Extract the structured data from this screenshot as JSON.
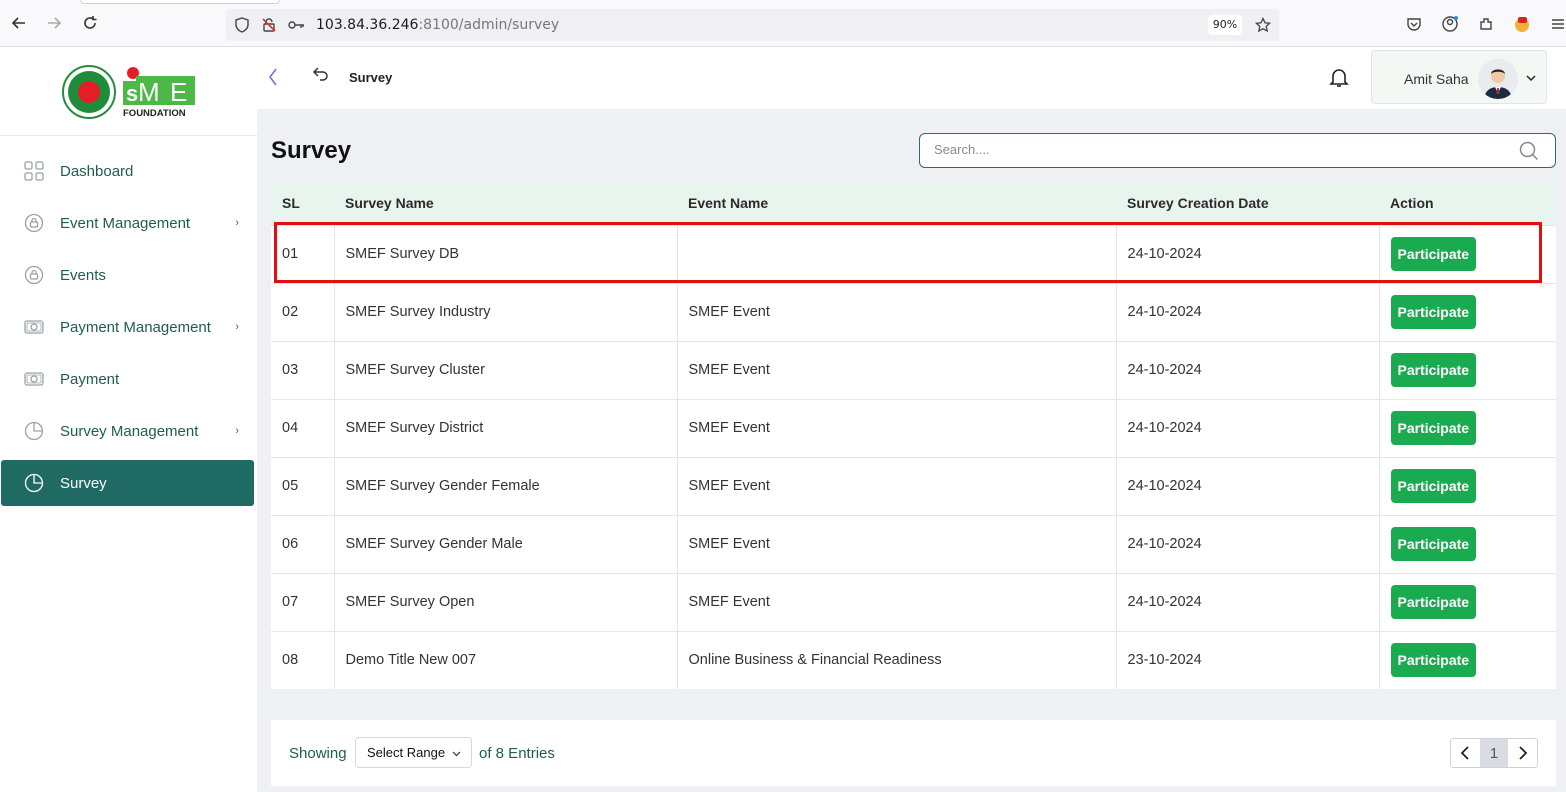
{
  "browser": {
    "url_main": "103.84.36.246",
    "url_rest": ":8100/admin/survey",
    "zoom": "90%"
  },
  "logo": {
    "brand": "SME",
    "sub": "FOUNDATION"
  },
  "sidebar": {
    "items": [
      {
        "label": "Dashboard",
        "icon": "grid-icon",
        "has_submenu": false
      },
      {
        "label": "Event Management",
        "icon": "lock-icon",
        "has_submenu": true
      },
      {
        "label": "Events",
        "icon": "lock-icon",
        "has_submenu": false
      },
      {
        "label": "Payment Management",
        "icon": "cash-icon",
        "has_submenu": true
      },
      {
        "label": "Payment",
        "icon": "cash-icon",
        "has_submenu": false
      },
      {
        "label": "Survey Management",
        "icon": "pie-chart-icon",
        "has_submenu": true
      },
      {
        "label": "Survey",
        "icon": "pie-chart-icon",
        "has_submenu": false,
        "active": true
      }
    ]
  },
  "header": {
    "breadcrumb": "Survey",
    "user_name": "Amit Saha"
  },
  "main": {
    "title": "Survey",
    "search_placeholder": "Search....",
    "columns": [
      "SL",
      "Survey Name",
      "Event Name",
      "Survey Creation Date",
      "Action"
    ],
    "rows": [
      {
        "sl": "01",
        "survey": "SMEF Survey DB",
        "event": "",
        "date": "24-10-2024",
        "action": "Participate"
      },
      {
        "sl": "02",
        "survey": "SMEF Survey Industry",
        "event": "SMEF Event",
        "date": "24-10-2024",
        "action": "Participate"
      },
      {
        "sl": "03",
        "survey": "SMEF Survey Cluster",
        "event": "SMEF Event",
        "date": "24-10-2024",
        "action": "Participate"
      },
      {
        "sl": "04",
        "survey": "SMEF Survey District",
        "event": "SMEF Event",
        "date": "24-10-2024",
        "action": "Participate"
      },
      {
        "sl": "05",
        "survey": "SMEF Survey Gender Female",
        "event": "SMEF Event",
        "date": "24-10-2024",
        "action": "Participate"
      },
      {
        "sl": "06",
        "survey": "SMEF Survey Gender Male",
        "event": "SMEF Event",
        "date": "24-10-2024",
        "action": "Participate"
      },
      {
        "sl": "07",
        "survey": "SMEF Survey Open",
        "event": "SMEF Event",
        "date": "24-10-2024",
        "action": "Participate"
      },
      {
        "sl": "08",
        "survey": "Demo Title New 007",
        "event": "Online Business & Financial Readiness",
        "date": "23-10-2024",
        "action": "Participate"
      }
    ]
  },
  "footer": {
    "showing": "Showing",
    "range_label": "Select Range",
    "entries_text": "of 8 Entries",
    "current_page": "1"
  },
  "colors": {
    "accent": "#1f6b63",
    "button": "#1aaa50",
    "header_row": "#e8f5ee",
    "highlight": "#e01010"
  }
}
